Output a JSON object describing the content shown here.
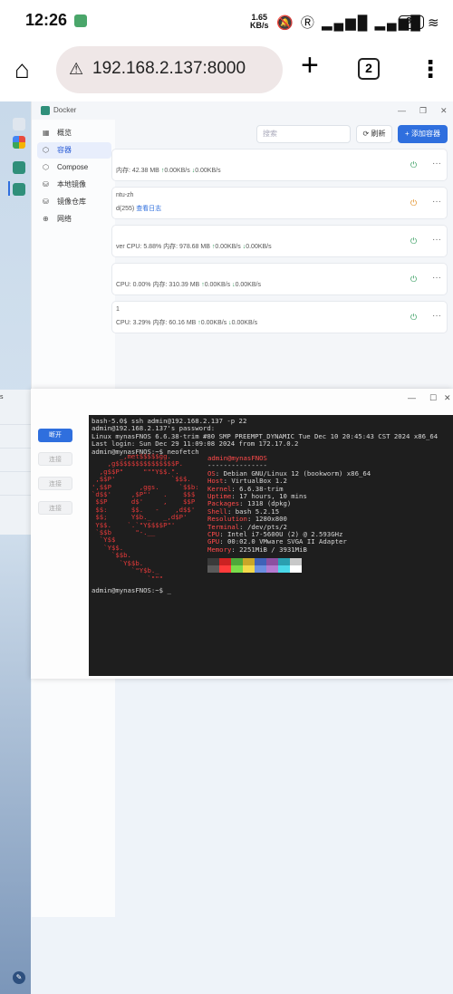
{
  "status_bar": {
    "time": "12:26",
    "net_speed_value": "1.65",
    "net_speed_unit": "KB/s",
    "signal_icons": "🔕 Ⓡ ▂▄▆█ ▂▄▆█ ≋",
    "battery": "84"
  },
  "browser": {
    "url": "192.168.2.137:8000",
    "tab_count": "2"
  },
  "docker_window": {
    "title": "Docker",
    "nav": [
      {
        "label": "概览",
        "icon": "▦"
      },
      {
        "label": "容器",
        "icon": "⬡"
      },
      {
        "label": "Compose",
        "icon": "⬡"
      },
      {
        "label": "本地镜像",
        "icon": "⛁"
      },
      {
        "label": "镜像仓库",
        "icon": "⛁"
      },
      {
        "label": "网络",
        "icon": "⊕"
      }
    ],
    "search_placeholder": "搜索",
    "refresh_label": "⟳ 刷新",
    "add_label": "+ 添加容器",
    "containers": [
      {
        "line1": "",
        "stats_cpu": "",
        "stats_mem": "内存: 42.38 MB",
        "up": "0.00KB/s",
        "down": "0.00KB/s",
        "status": "running"
      },
      {
        "line1": "ntu-zh",
        "line2_prefix": "d(255)",
        "line2_link": "查看日志",
        "status": "exited"
      },
      {
        "line1": "",
        "stats_cpu": "ver   CPU: 5.88%",
        "stats_mem": "内存: 978.68 MB",
        "up": "0.00KB/s",
        "down": "0.00KB/s",
        "status": "running"
      },
      {
        "line1": "",
        "stats_cpu": "CPU: 0.00%",
        "stats_mem": "内存: 310.39 MB",
        "up": "0.00KB/s",
        "down": "0.00KB/s",
        "status": "running"
      },
      {
        "line1": "1",
        "stats_cpu": "CPU: 3.29%",
        "stats_mem": "内存: 60.16 MB",
        "up": "0.00KB/s",
        "down": "0.00KB/s",
        "status": "running"
      }
    ]
  },
  "ssh_window": {
    "disconnect_label": "断开",
    "connect_labels": [
      "连接",
      "连接",
      "连接"
    ],
    "terminal": {
      "header_lines": "bash-5.0$ ssh admin@192.168.2.137 -p 22\nadmin@192.168.2.137's password:\nLinux mynasFNOS 6.6.38-trim #80 SMP PREEMPT_DYNAMIC Tue Dec 10 20:45:43 CST 2024 x86_64\nLast login: Sun Dec 29 11:09:08 2024 from 172.17.0.2\nadmin@mynasFNOS:~$ neofetch",
      "logo": "       _,met$$$$$gg.\n    ,g$$$$$$$$$$$$$$$P.\n  ,g$$P\"     \"\"\"Y$$.\".\n ,$$P'              `$$$.\n',$$P       ,ggs.     `$$b:\n`d$$'     ,$P\"'   .    $$$\n $$P      d$'     ,    $$P\n $$:      $$.   -    ,d$$'\n $$;      Y$b._   _,d$P'\n Y$$.    `.`\"Y$$$$P\"'\n `$$b      \"-.__\n  `Y$$\n   `Y$$.\n     `$$b.\n       `Y$$b.\n          `\"Y$b._\n              `\"\"\"",
      "userhost": "admin@mynasFNOS",
      "separator": "---------------",
      "info": [
        {
          "key": "OS",
          "value": "Debian GNU/Linux 12 (bookworm) x86_64"
        },
        {
          "key": "Host",
          "value": "VirtualBox 1.2"
        },
        {
          "key": "Kernel",
          "value": "6.6.38-trim"
        },
        {
          "key": "Uptime",
          "value": "17 hours, 10 mins"
        },
        {
          "key": "Packages",
          "value": "1318 (dpkg)"
        },
        {
          "key": "Shell",
          "value": "bash 5.2.15"
        },
        {
          "key": "Resolution",
          "value": "1280x800"
        },
        {
          "key": "Terminal",
          "value": "/dev/pts/2"
        },
        {
          "key": "CPU",
          "value": "Intel i7-5600U (2) @ 2.593GHz"
        },
        {
          "key": "GPU",
          "value": "00:02.0 VMware SVGA II Adapter"
        },
        {
          "key": "Memory",
          "value": "2251MiB / 3931MiB"
        }
      ],
      "colors_row1": [
        "#3a3a3a",
        "#cc2222",
        "#4ea83a",
        "#c9a628",
        "#3f62b8",
        "#8c4fa0",
        "#2a9fb0",
        "#c8c8c8"
      ],
      "colors_row2": [
        "#5a5a5a",
        "#ff3b3b",
        "#7adc4a",
        "#f4d94a",
        "#6b8fe0",
        "#b47ad0",
        "#4ad8e8",
        "#ffffff"
      ],
      "prompt": "admin@mynasFNOS:~$ _"
    }
  }
}
